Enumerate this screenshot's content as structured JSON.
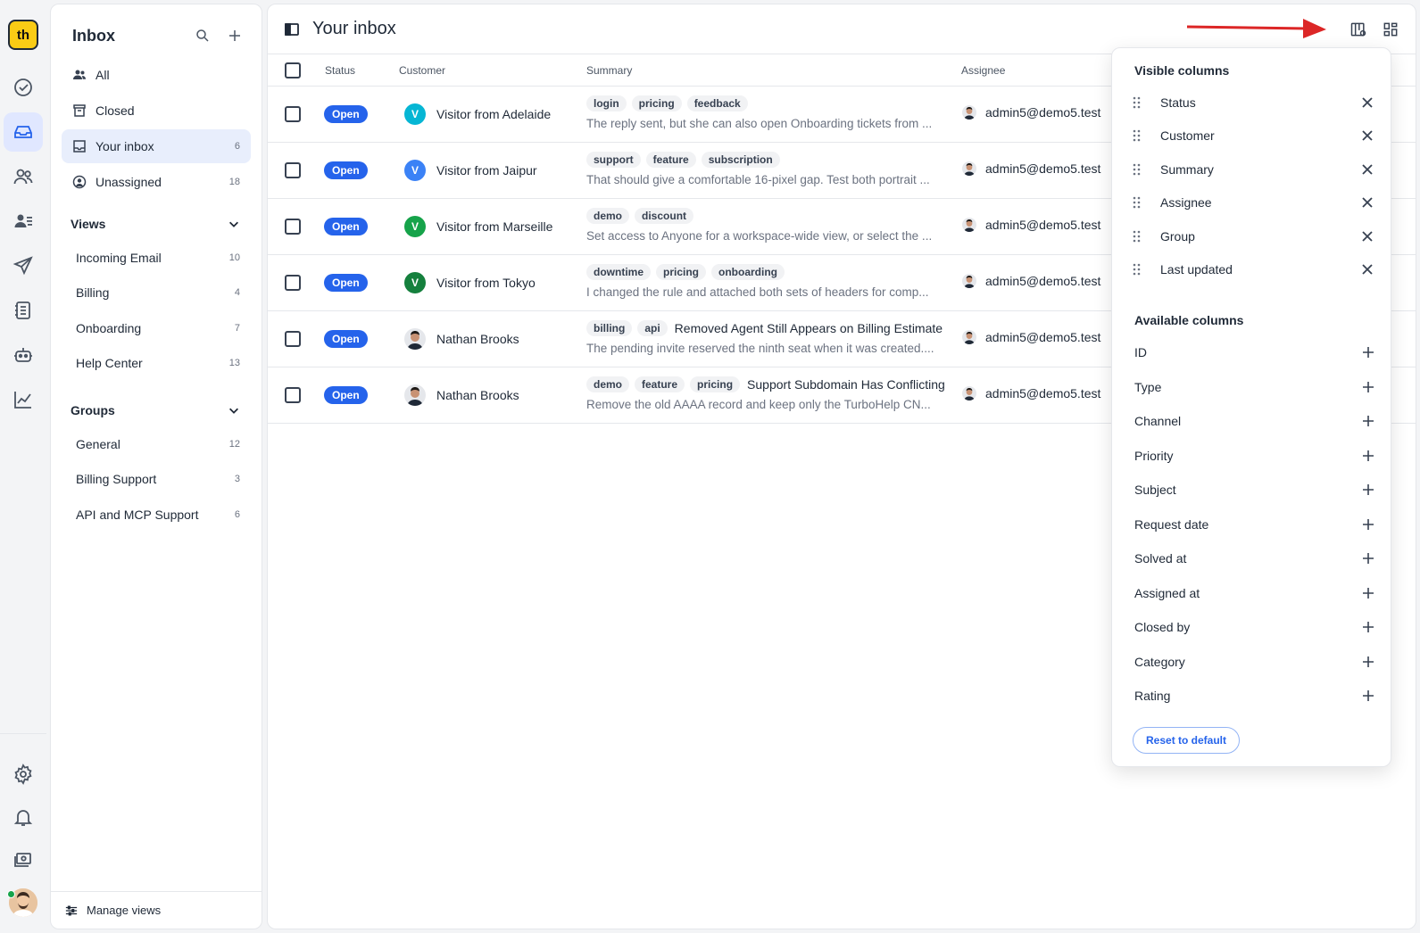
{
  "brand": {
    "logo_text": "th",
    "accent": "#2563eb",
    "logo_color": "#facc15"
  },
  "sidebar": {
    "title": "Inbox",
    "nav": [
      {
        "label": "All",
        "count": ""
      },
      {
        "label": "Closed",
        "count": ""
      },
      {
        "label": "Your inbox",
        "count": "6"
      },
      {
        "label": "Unassigned",
        "count": "18"
      }
    ],
    "views_title": "Views",
    "views": [
      {
        "label": "Incoming Email",
        "count": "10"
      },
      {
        "label": "Billing",
        "count": "4"
      },
      {
        "label": "Onboarding",
        "count": "7"
      },
      {
        "label": "Help Center",
        "count": "13"
      }
    ],
    "groups_title": "Groups",
    "groups": [
      {
        "label": "General",
        "count": "12"
      },
      {
        "label": "Billing Support",
        "count": "3"
      },
      {
        "label": "API and MCP Support",
        "count": "6"
      }
    ],
    "footer_label": "Manage views"
  },
  "main": {
    "title": "Your inbox",
    "columns": {
      "status": "Status",
      "customer": "Customer",
      "summary": "Summary",
      "assignee": "Assignee"
    },
    "rows": [
      {
        "status": "Open",
        "avatar_letter": "V",
        "avatar_color": "#06b6d4",
        "customer": "Visitor from Adelaide",
        "tags": [
          "login",
          "pricing",
          "feedback"
        ],
        "subject": "",
        "snippet": "The reply sent, but she can also open Onboarding tickets from ...",
        "assignee": "admin5@demo5.test"
      },
      {
        "status": "Open",
        "avatar_letter": "V",
        "avatar_color": "#3b82f6",
        "customer": "Visitor from Jaipur",
        "tags": [
          "support",
          "feature",
          "subscription"
        ],
        "subject": "",
        "snippet": "That should give a comfortable 16-pixel gap. Test both portrait ...",
        "assignee": "admin5@demo5.test"
      },
      {
        "status": "Open",
        "avatar_letter": "V",
        "avatar_color": "#16a34a",
        "customer": "Visitor from Marseille",
        "tags": [
          "demo",
          "discount"
        ],
        "subject": "",
        "snippet": "Set access to Anyone for a workspace-wide view, or select the ...",
        "assignee": "admin5@demo5.test"
      },
      {
        "status": "Open",
        "avatar_letter": "V",
        "avatar_color": "#15803d",
        "customer": "Visitor from Tokyo",
        "tags": [
          "downtime",
          "pricing",
          "onboarding"
        ],
        "subject": "",
        "snippet": "I changed the rule and attached both sets of headers for comp...",
        "assignee": "admin5@demo5.test"
      },
      {
        "status": "Open",
        "avatar_letter": "",
        "avatar_color": "",
        "customer": "Nathan Brooks",
        "tags": [
          "billing",
          "api"
        ],
        "subject": "Removed Agent Still Appears on Billing Estimate",
        "snippet": "The pending invite reserved the ninth seat when it was created....",
        "assignee": "admin5@demo5.test"
      },
      {
        "status": "Open",
        "avatar_letter": "",
        "avatar_color": "",
        "customer": "Nathan Brooks",
        "tags": [
          "demo",
          "feature",
          "pricing"
        ],
        "subject": "Support Subdomain Has Conflicting",
        "snippet": "Remove the old AAAA record and keep only the TurboHelp CN...",
        "assignee": "admin5@demo5.test"
      }
    ]
  },
  "popover": {
    "visible_title": "Visible columns",
    "visible": [
      "Status",
      "Customer",
      "Summary",
      "Assignee",
      "Group",
      "Last updated"
    ],
    "available_title": "Available columns",
    "available": [
      "ID",
      "Type",
      "Channel",
      "Priority",
      "Subject",
      "Request date",
      "Solved at",
      "Assigned at",
      "Closed by",
      "Category",
      "Rating"
    ],
    "reset_label": "Reset to default"
  }
}
